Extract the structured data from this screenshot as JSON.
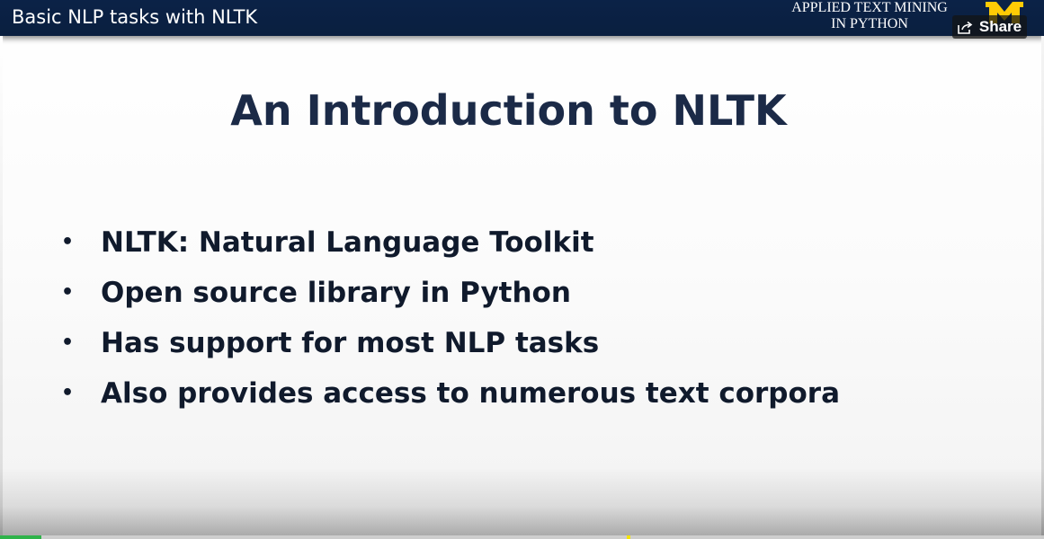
{
  "header": {
    "video_title": "Basic NLP tasks with NLTK",
    "course_name": "APPLIED TEXT MINING\nIN PYTHON",
    "share_label": "Share",
    "logo_icon": "university-m-logo-icon",
    "share_icon": "share-arrow-icon"
  },
  "slide": {
    "title": "An Introduction to NLTK",
    "bullets": [
      {
        "text": "NLTK: Natural Language Toolkit"
      },
      {
        "text": "Open source library in Python"
      },
      {
        "text": "Has support for most NLP tasks"
      },
      {
        "text": "Also provides access to numerous text corpora"
      }
    ]
  },
  "player": {
    "progress_fraction": 0.04,
    "marker_fraction": 0.6
  },
  "colors": {
    "header_bg": "#0b2247",
    "title_text": "#1b2a47",
    "bullet_text": "#101a2c",
    "logo_maize": "#ffcb05",
    "progress_played": "#2fb34a",
    "progress_marker": "#f5e400"
  }
}
